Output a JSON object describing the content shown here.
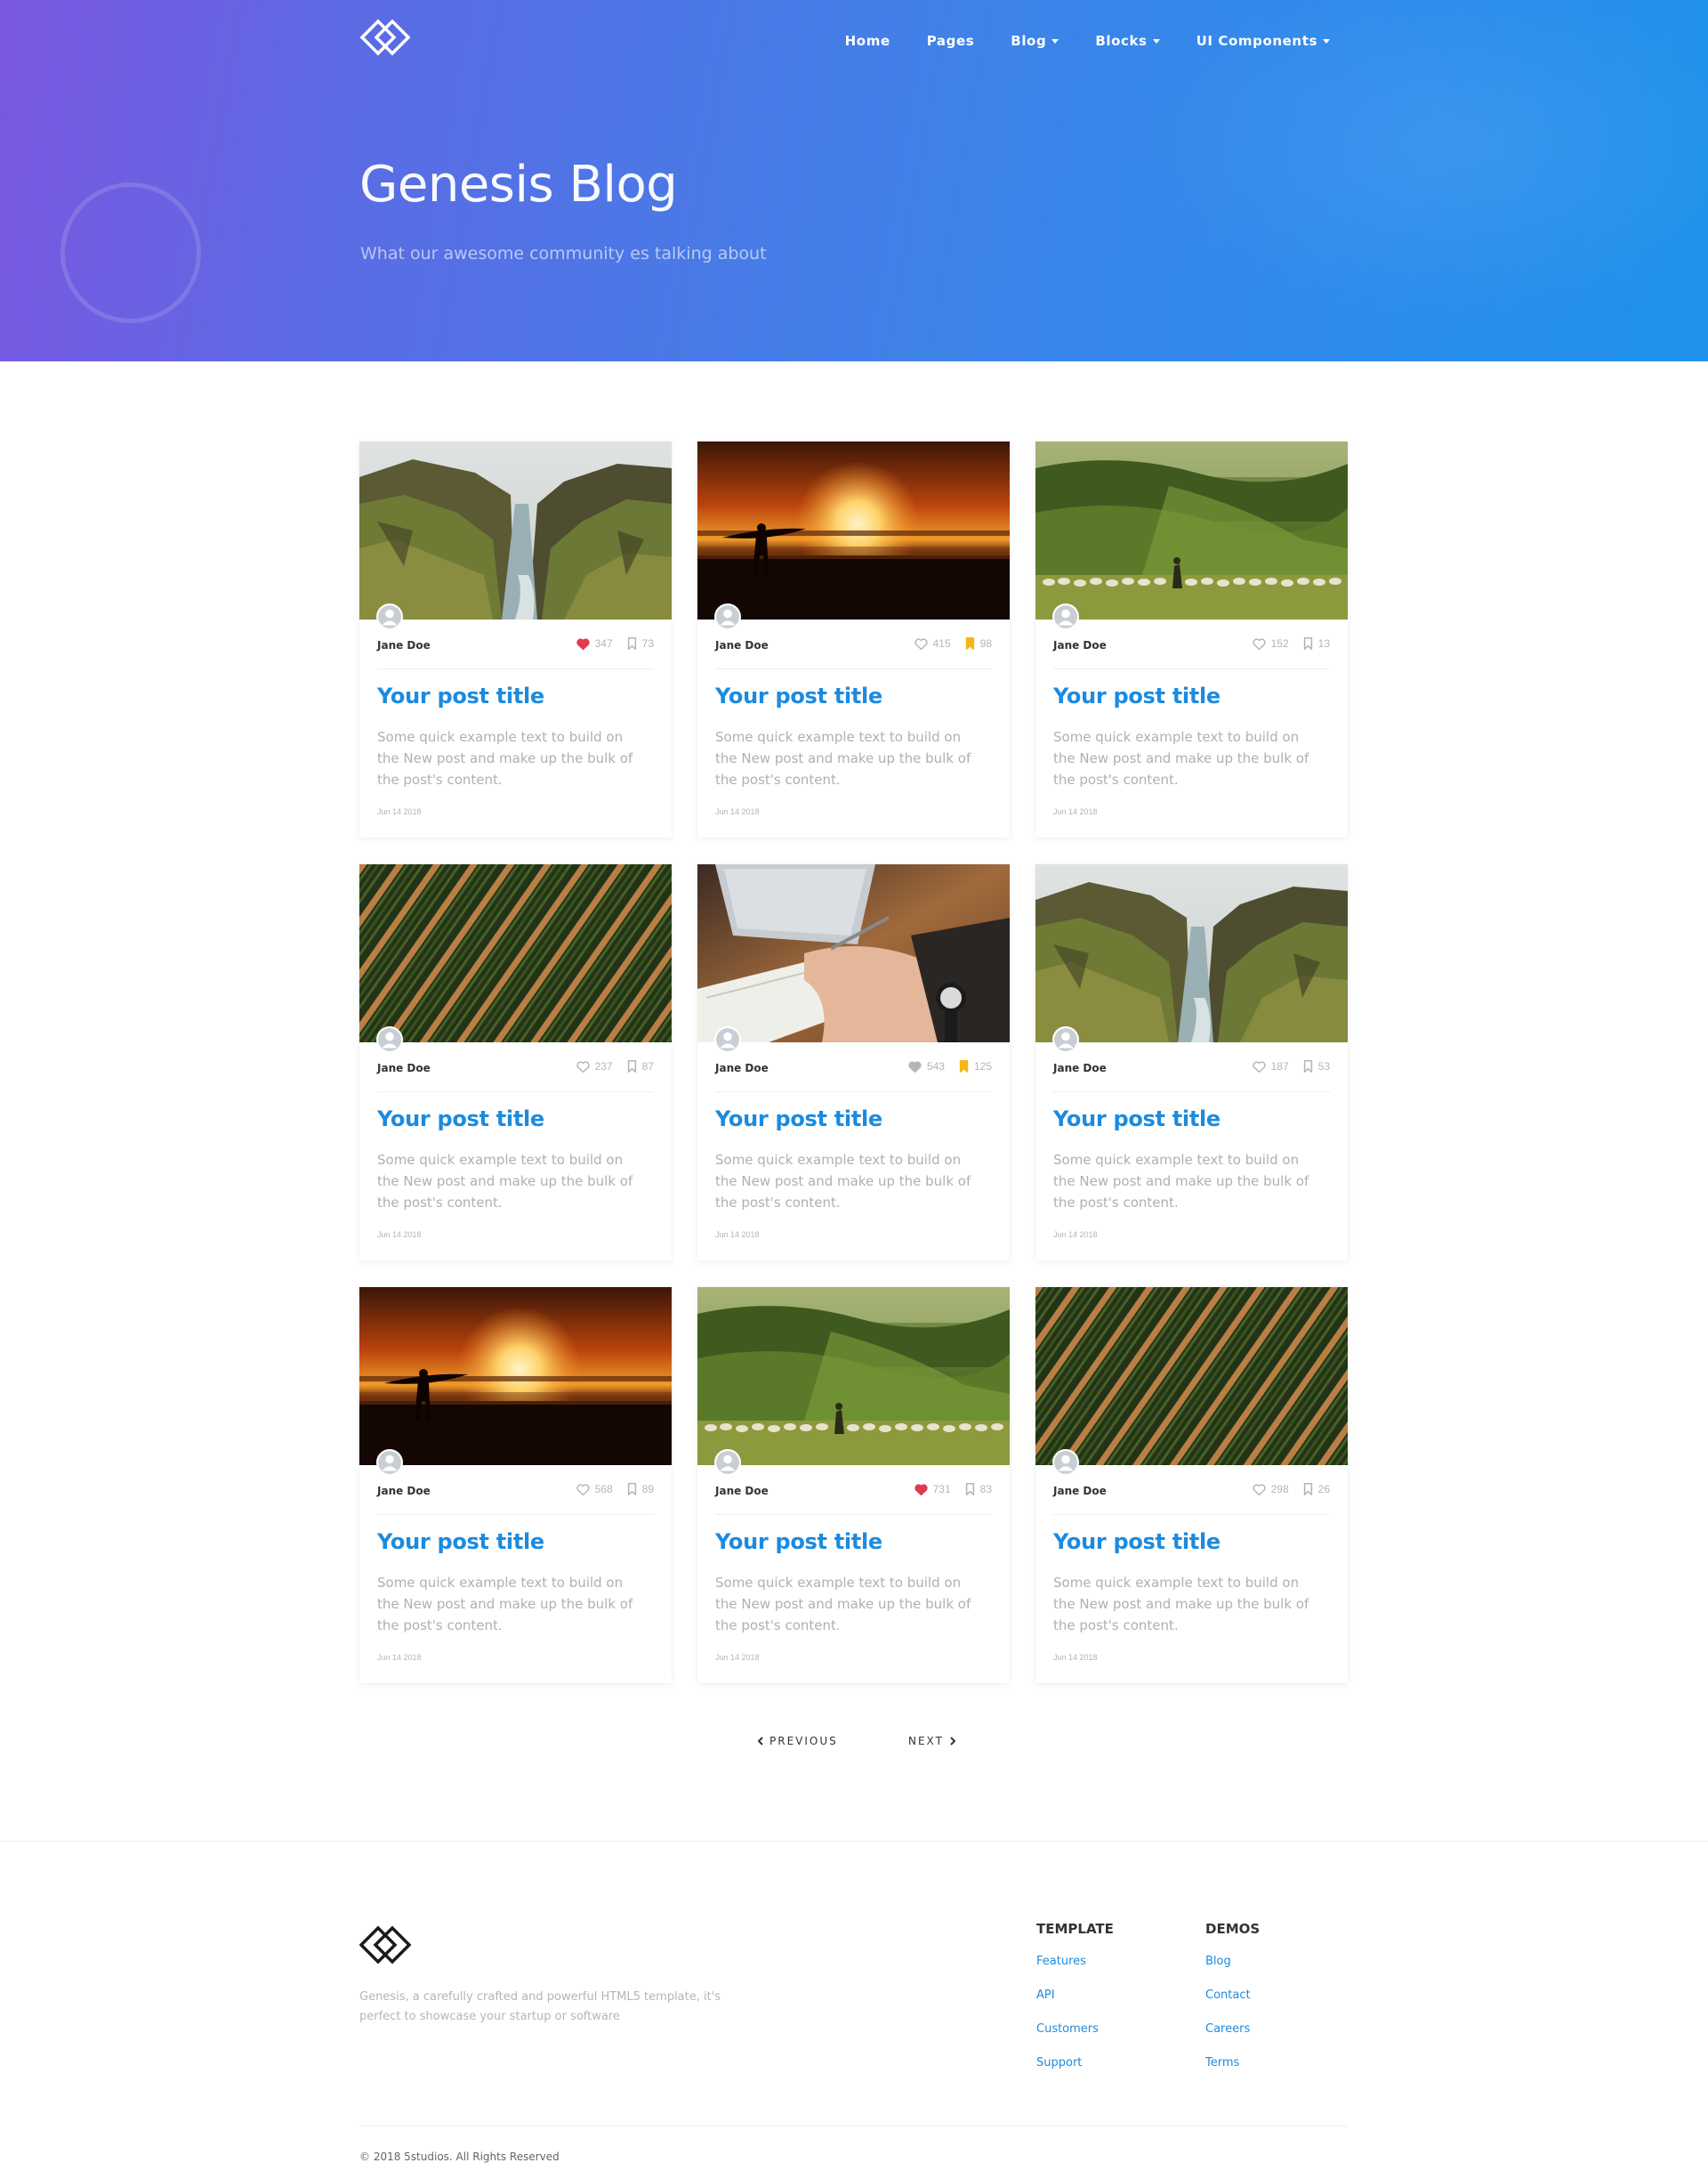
{
  "nav": {
    "brand_icon": "genesis-logo-icon",
    "items": [
      {
        "label": "Home",
        "dropdown": false
      },
      {
        "label": "Pages",
        "dropdown": false
      },
      {
        "label": "Blog",
        "dropdown": true
      },
      {
        "label": "Blocks",
        "dropdown": true
      },
      {
        "label": "UI Components",
        "dropdown": true
      }
    ]
  },
  "hero": {
    "title": "Genesis Blog",
    "subtitle": "What our awesome community es talking about"
  },
  "colors": {
    "accent": "#1c8bdf",
    "like_active": "#e03a4e",
    "bookmark_active": "#f6b617",
    "gradient_start": "#7b57e0",
    "gradient_end": "#1f92ea"
  },
  "posts": [
    {
      "image": "canyon",
      "author": "Jane Doe",
      "likes": "347",
      "liked": true,
      "bookmarks": "73",
      "bookmarked": false,
      "title": "Your post title",
      "excerpt": "Some quick example text to build on the New post and make up the bulk of the post's content.",
      "date": "Jun 14 2018"
    },
    {
      "image": "sunset-surfer",
      "author": "Jane Doe",
      "likes": "415",
      "liked": false,
      "bookmarks": "98",
      "bookmarked": true,
      "title": "Your post title",
      "excerpt": "Some quick example text to build on the New post and make up the bulk of the post's content.",
      "date": "Jun 14 2018"
    },
    {
      "image": "sheep-valley",
      "author": "Jane Doe",
      "likes": "152",
      "liked": false,
      "bookmarks": "13",
      "bookmarked": false,
      "title": "Your post title",
      "excerpt": "Some quick example text to build on the New post and make up the bulk of the post's content.",
      "date": "Jun 14 2018"
    },
    {
      "image": "crop-rows",
      "author": "Jane Doe",
      "likes": "237",
      "liked": false,
      "bookmarks": "87",
      "bookmarked": false,
      "title": "Your post title",
      "excerpt": "Some quick example text to build on the New post and make up the bulk of the post's content.",
      "date": "Jun 14 2018"
    },
    {
      "image": "writing-desk",
      "author": "Jane Doe",
      "likes": "543",
      "liked": "filled-grey",
      "bookmarks": "125",
      "bookmarked": true,
      "title": "Your post title",
      "excerpt": "Some quick example text to build on the New post and make up the bulk of the post's content.",
      "date": "Jun 14 2018"
    },
    {
      "image": "canyon",
      "author": "Jane Doe",
      "likes": "187",
      "liked": false,
      "bookmarks": "53",
      "bookmarked": false,
      "title": "Your post title",
      "excerpt": "Some quick example text to build on the New post and make up the bulk of the post's content.",
      "date": "Jun 14 2018"
    },
    {
      "image": "sunset-surfer",
      "author": "Jane Doe",
      "likes": "568",
      "liked": false,
      "bookmarks": "89",
      "bookmarked": false,
      "title": "Your post title",
      "excerpt": "Some quick example text to build on the New post and make up the bulk of the post's content.",
      "date": "Jun 14 2018"
    },
    {
      "image": "sheep-valley",
      "author": "Jane Doe",
      "likes": "731",
      "liked": true,
      "bookmarks": "83",
      "bookmarked": false,
      "title": "Your post title",
      "excerpt": "Some quick example text to build on the New post and make up the bulk of the post's content.",
      "date": "Jun 14 2018"
    },
    {
      "image": "crop-rows",
      "author": "Jane Doe",
      "likes": "298",
      "liked": false,
      "bookmarks": "26",
      "bookmarked": false,
      "title": "Your post title",
      "excerpt": "Some quick example text to build on the New post and make up the bulk of the post's content.",
      "date": "Jun 14 2018"
    }
  ],
  "pagination": {
    "previous": "PREVIOUS",
    "next": "NEXT"
  },
  "footer": {
    "description": "Genesis, a carefully crafted and powerful HTML5 template, it's perfect to showcase your startup or software",
    "columns": [
      {
        "heading": "TEMPLATE",
        "links": [
          "Features",
          "API",
          "Customers",
          "Support"
        ]
      },
      {
        "heading": "DEMOS",
        "links": [
          "Blog",
          "Contact",
          "Careers",
          "Terms"
        ]
      }
    ],
    "copyright": "© 2018 5studios. All Rights Reserved"
  }
}
